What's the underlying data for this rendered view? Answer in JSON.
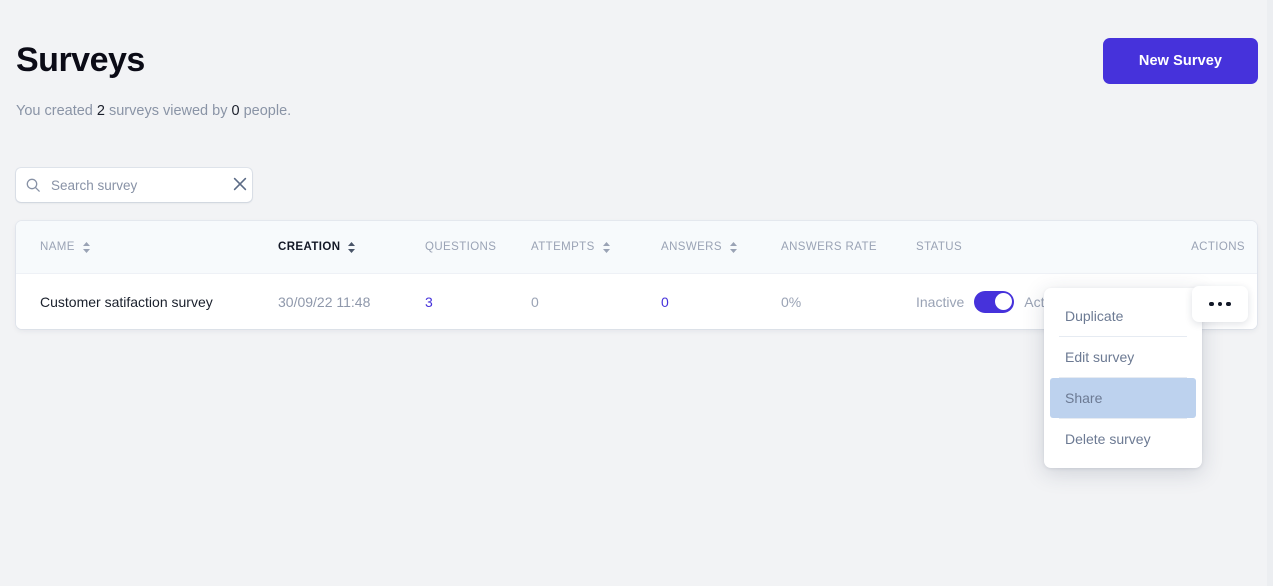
{
  "header": {
    "title": "Surveys",
    "subtitle_prefix": "You created ",
    "survey_count": "2",
    "subtitle_middle": " surveys viewed by ",
    "people_count": "0",
    "subtitle_suffix": " people.",
    "new_survey_label": "New Survey",
    "accent_color": "#4632db"
  },
  "search": {
    "placeholder": "Search survey",
    "value": "",
    "icon": "search-icon",
    "clear_icon": "close-icon"
  },
  "table": {
    "columns": [
      {
        "label": "NAME",
        "sortable": true,
        "active": false
      },
      {
        "label": "CREATION",
        "sortable": true,
        "active": true
      },
      {
        "label": "QUESTIONS",
        "sortable": false,
        "active": false
      },
      {
        "label": "ATTEMPTS",
        "sortable": true,
        "active": false
      },
      {
        "label": "ANSWERS",
        "sortable": true,
        "active": false
      },
      {
        "label": "ANSWERS RATE",
        "sortable": false,
        "active": false
      },
      {
        "label": "STATUS",
        "sortable": false,
        "active": false
      },
      {
        "label": "ACTIONS",
        "sortable": false,
        "active": false
      }
    ],
    "rows": [
      {
        "name": "Customer satifaction survey",
        "creation": "30/09/22 11:48",
        "questions": "3",
        "attempts": "0",
        "answers": "0",
        "answers_rate": "0%",
        "status_off_label": "Inactive",
        "status_on_label": "Active",
        "status_enabled": true,
        "actions_icon": "ellipsis-icon"
      }
    ]
  },
  "dropdown": {
    "items": [
      {
        "label": "Duplicate",
        "highlighted": false
      },
      {
        "label": "Edit survey",
        "highlighted": false
      },
      {
        "label": "Share",
        "highlighted": true
      },
      {
        "label": "Delete survey",
        "highlighted": false
      }
    ],
    "highlight_color": "#bdd2ee"
  }
}
